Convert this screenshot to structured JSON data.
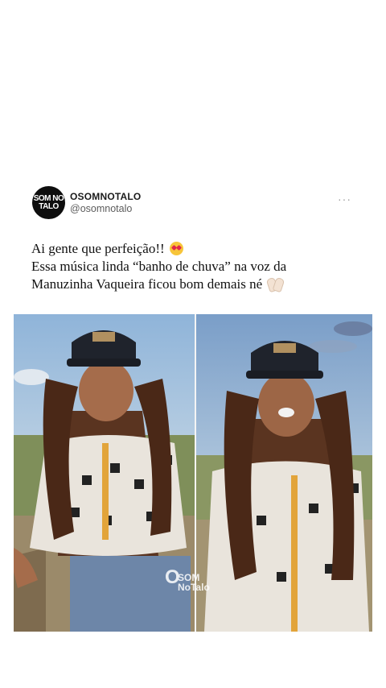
{
  "post": {
    "avatar_lines": [
      "SOM NO",
      "TALO"
    ],
    "display_name": "OSOMNOTALO",
    "handle": "@osomnotalo",
    "more_icon": "more-horizontal-icon",
    "more_glyph": "···"
  },
  "caption": {
    "line1": "Ai gente que perfeição!!",
    "line1_emoji": "heart-eyes-emoji",
    "line2": "Essa música linda “banho de chuva” na voz da",
    "line3": "Manuzinha Vaqueira ficou bom demais né",
    "line3_emoji": "clapping-hands-emoji"
  },
  "media": {
    "panels": [
      "photo-left",
      "photo-right"
    ],
    "watermark": {
      "big": "O",
      "top": "SOM",
      "bottom": "NoTalo"
    }
  }
}
